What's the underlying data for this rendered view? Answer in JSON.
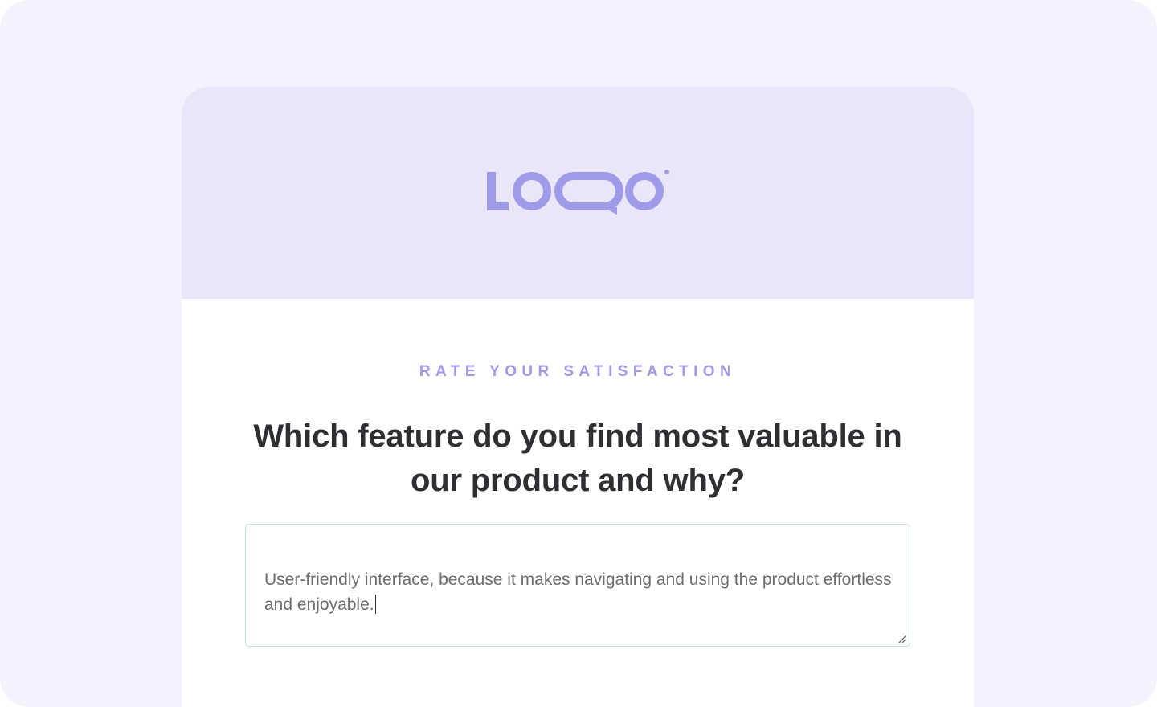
{
  "brand": {
    "logo_text": "LOQO",
    "accent_color": "#a09be8",
    "header_bg": "#e8e6f8",
    "page_bg": "#f3f2fe"
  },
  "survey": {
    "eyebrow": "RATE YOUR SATISFACTION",
    "question": "Which feature do you find most valuable in our product and why?",
    "answer_value": "User-friendly interface, because it makes navigating and using the product effortless and enjoyable."
  }
}
